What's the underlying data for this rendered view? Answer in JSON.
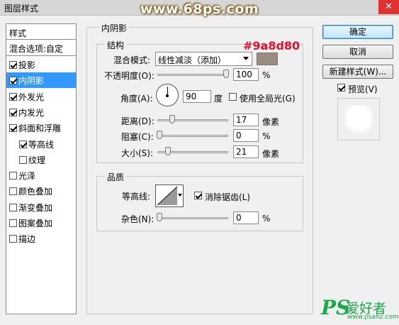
{
  "window": {
    "title": "图层样式",
    "close_glyph": "✕"
  },
  "watermark_top": "www.68ps.com",
  "style_list": {
    "header": "样式",
    "blend_options": "混合选项:自定",
    "items": [
      {
        "label": "投影",
        "checked": true,
        "selected": false,
        "indent": false
      },
      {
        "label": "内阴影",
        "checked": true,
        "selected": true,
        "indent": false
      },
      {
        "label": "外发光",
        "checked": true,
        "selected": false,
        "indent": false
      },
      {
        "label": "内发光",
        "checked": true,
        "selected": false,
        "indent": false
      },
      {
        "label": "斜面和浮雕",
        "checked": true,
        "selected": false,
        "indent": false
      },
      {
        "label": "等高线",
        "checked": true,
        "selected": false,
        "indent": true
      },
      {
        "label": "纹理",
        "checked": false,
        "selected": false,
        "indent": true
      },
      {
        "label": "光泽",
        "checked": false,
        "selected": false,
        "indent": false
      },
      {
        "label": "颜色叠加",
        "checked": false,
        "selected": false,
        "indent": false
      },
      {
        "label": "渐变叠加",
        "checked": false,
        "selected": false,
        "indent": false
      },
      {
        "label": "图案叠加",
        "checked": false,
        "selected": false,
        "indent": false
      },
      {
        "label": "描边",
        "checked": false,
        "selected": false,
        "indent": false
      }
    ]
  },
  "panel": {
    "title": "内阴影",
    "structure": {
      "title": "结构",
      "blend_mode_label": "混合模式:",
      "blend_mode_value": "线性减淡（添加）",
      "shadow_color": "#9a8d80",
      "color_annotation": "#9a8d80",
      "opacity_label": "不透明度(O):",
      "opacity_value": "100",
      "opacity_unit": "%",
      "opacity_fraction": 1.0,
      "angle_label": "角度(A):",
      "angle_value": "90",
      "angle_unit": "度",
      "global_light_label": "使用全局光(G)",
      "global_light_checked": false,
      "distance_label": "距离(D):",
      "distance_value": "17",
      "distance_unit": "像素",
      "distance_fraction": 0.068,
      "choke_label": "阻塞(C):",
      "choke_value": "0",
      "choke_unit": "%",
      "choke_fraction": 0.0,
      "size_label": "大小(S):",
      "size_value": "21",
      "size_unit": "像素",
      "size_fraction": 0.084
    },
    "quality": {
      "title": "品质",
      "contour_label": "等高线:",
      "antialias_label": "消除锯齿(L)",
      "antialias_checked": true,
      "noise_label": "杂色(N):",
      "noise_value": "0",
      "noise_unit": "%",
      "noise_fraction": 0.0
    }
  },
  "buttons": {
    "ok": "确定",
    "cancel": "取消",
    "new_style": "新建样式(W)...",
    "preview_label": "预览(V)",
    "preview_checked": true
  },
  "watermark_bottom": {
    "ps": "PS",
    "cn": "爱好者",
    "url": "www.psahz.com"
  }
}
